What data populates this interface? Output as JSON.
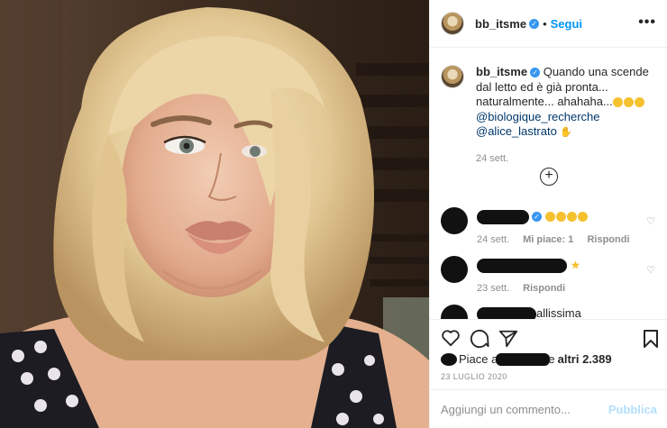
{
  "header": {
    "username": "bb_itsme",
    "separator": "•",
    "follow_label": "Segui",
    "more_label": "•••"
  },
  "caption": {
    "username": "bb_itsme",
    "text": "Quando una scende dal letto ed è già pronta... naturalmente... ahahaha...",
    "mention1": "@biologique_recherche",
    "mention2": "@alice_lastrato",
    "timestamp": "24 sett."
  },
  "load_more_label": "+",
  "comments": [
    {
      "time": "24 sett.",
      "likes": "Mi piace: 1",
      "reply": "Rispondi",
      "suffix_emoji_count": 4
    },
    {
      "time": "23 sett.",
      "reply": "Rispondi",
      "star": "★"
    },
    {
      "partial_text": "allissima"
    }
  ],
  "likes_line": {
    "prefix": "Piace a",
    "suffix": "e",
    "count": "altri 2.389"
  },
  "date": "23 LUGLIO 2020",
  "add_comment": {
    "placeholder": "Aggiungi un commento...",
    "publish_label": "Pubblica"
  },
  "colors": {
    "accent": "#0095f6",
    "publish_disabled": "#b2dffc",
    "muted": "#8e8e8e",
    "verified": "#3897f0"
  }
}
